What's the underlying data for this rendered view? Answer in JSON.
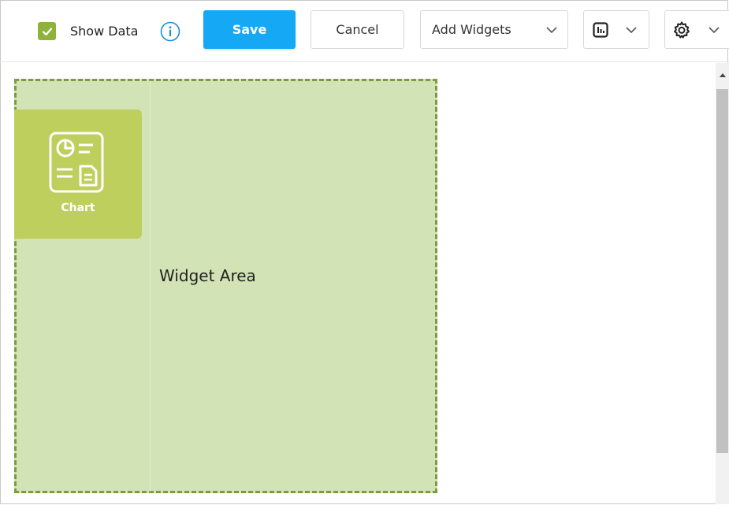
{
  "toolbar": {
    "show_data_label": "Show Data",
    "show_data_checked": true,
    "save_label": "Save",
    "cancel_label": "Cancel",
    "add_widgets_label": "Add Widgets",
    "icons": {
      "checkbox": "check-icon",
      "info": "info-icon",
      "chart_view": "chart-view-icon",
      "settings": "gear-icon",
      "dropdown": "chevron-down-icon"
    }
  },
  "canvas": {
    "widget_area_label": "Widget Area",
    "chart_widget_label": "Chart"
  },
  "colors": {
    "accent_save": "#14a8f5",
    "checkbox": "#8fb23a",
    "widget_area_fill": "#d2e4b5",
    "widget_area_border": "#7f9a3f",
    "chart_tile": "#bfcf5e"
  }
}
